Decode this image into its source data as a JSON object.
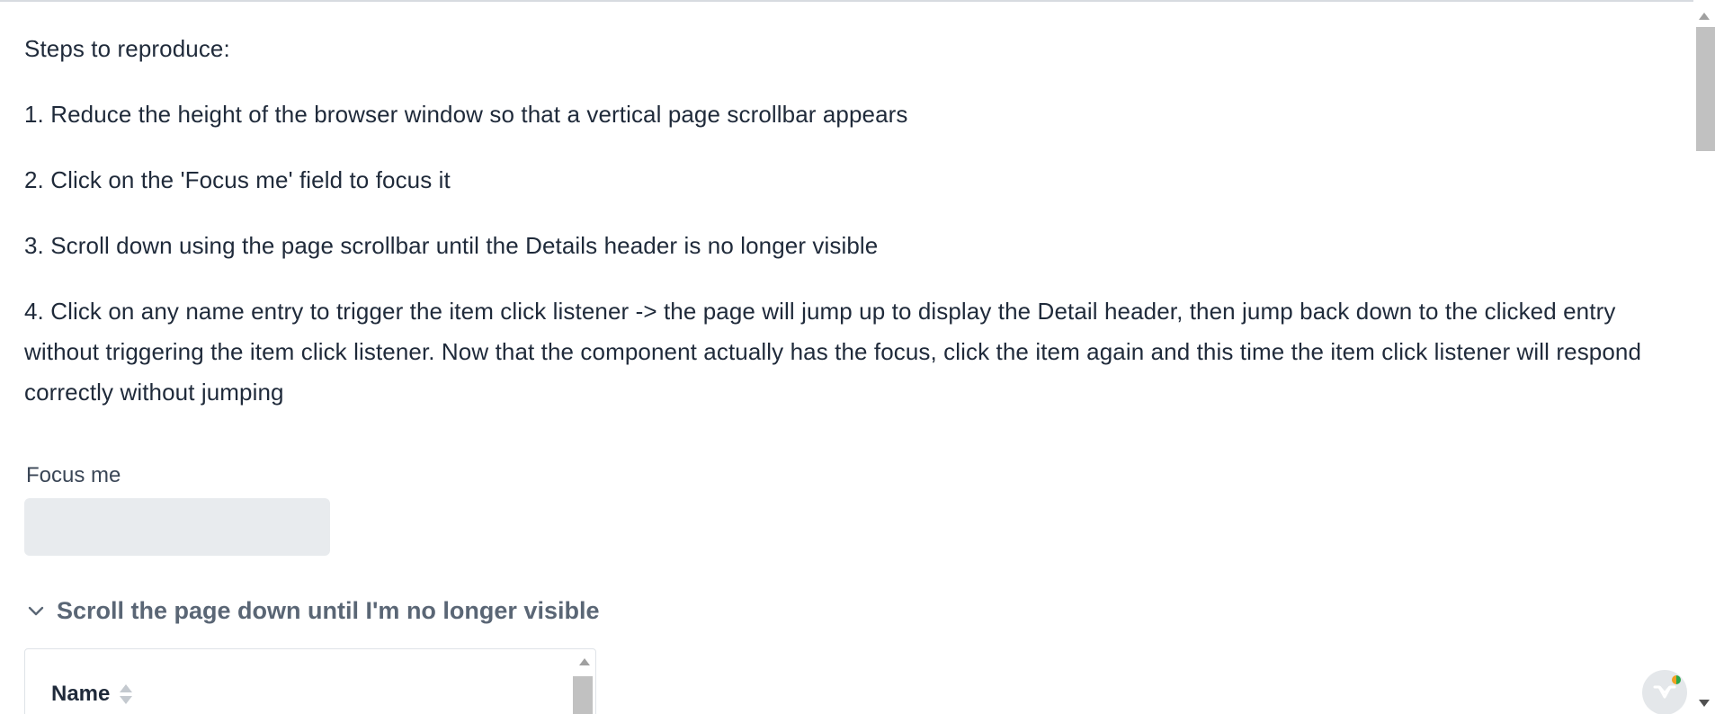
{
  "instructions": {
    "heading": "Steps to reproduce:",
    "step1": "1. Reduce the height of the browser window so that a vertical page scrollbar appears",
    "step2": "2. Click on the 'Focus me' field to focus it",
    "step3": "3. Scroll down using the page scrollbar until the Details header is no longer visible",
    "step4": "4. Click on any name entry to trigger the item click listener -> the page will jump up to display the Detail header, then jump back down to the clicked entry without triggering the item click listener. Now that the component actually has the focus, click the item again and this time the item click listener will respond correctly without jumping"
  },
  "focus_field": {
    "label": "Focus me",
    "value": "",
    "placeholder": ""
  },
  "details": {
    "summary": "Scroll the page down until I'm no longer visible",
    "expanded": true,
    "chevron_icon": "chevron-down-icon"
  },
  "grid": {
    "columns": [
      {
        "header": "Name",
        "sort_icon": "sort-icon"
      }
    ]
  },
  "dev_badge": {
    "icon": "vaadin-logo-icon",
    "status_color_left": "#f0a020",
    "status_color_right": "#2aa84a"
  },
  "colors": {
    "text": "#1f2a3a",
    "field_background": "#e8ebee",
    "details_summary": "#5a6675"
  }
}
